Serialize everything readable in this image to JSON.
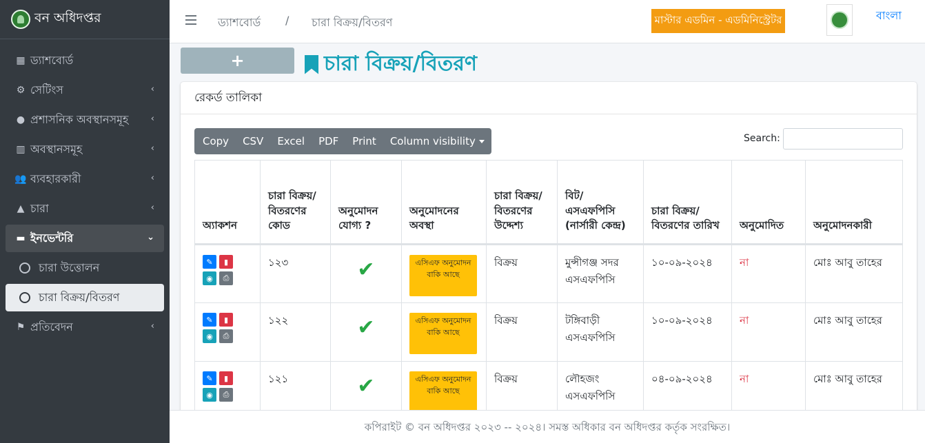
{
  "brand": {
    "title": "বন অধিদপ্তর"
  },
  "sidebar": {
    "items": [
      {
        "icon": "grid-icon",
        "label": "ড্যাশবোর্ড"
      },
      {
        "icon": "gear-icon",
        "label": "সেটিংস"
      },
      {
        "icon": "location-pin-icon",
        "label": "প্রশাসনিক অবস্থানসমূহ"
      },
      {
        "icon": "building-icon",
        "label": "অবস্থানসমূহ"
      },
      {
        "icon": "users-icon",
        "label": "ব্যবহারকারী"
      },
      {
        "icon": "tree-icon",
        "label": "চারা"
      },
      {
        "icon": "toolbox-icon",
        "label": "ইনভেন্টরি"
      },
      {
        "label": "চারা উত্তোলন"
      },
      {
        "label": "চারা বিক্রয়/বিতরণ"
      },
      {
        "icon": "flag-icon",
        "label": "প্রতিবেদন"
      }
    ]
  },
  "topbar": {
    "breadcrumb": [
      "ড্যাশবোর্ড",
      "/",
      "চারা বিক্রয়/বিতরণ"
    ],
    "role": "মাস্টার এডমিন - এডমিনিস্ট্রেটর",
    "language": "বাংলা"
  },
  "page": {
    "add_label": "+",
    "title": "চারা বিক্রয়/বিতরণ"
  },
  "card": {
    "header": "রেকর্ড তালিকা",
    "buttons": [
      "Copy",
      "CSV",
      "Excel",
      "PDF",
      "Print",
      "Column visibility"
    ],
    "search_label": "Search:"
  },
  "table": {
    "columns": [
      "অ্যাকশন",
      "চারা বিক্রয়/ বিতরণের কোড",
      "অনুমোদন যোগ্য ?",
      "অনুমোদনের অবস্থা",
      "চারা বিক্রয়/ বিতরণের উদ্দেশ্য",
      "বিট/ এসএফপিসি (নার্সারী কেন্দ্র)",
      "চারা বিক্রয়/ বিতরণের তারিখ",
      "অনুমোদিত",
      "অনুমোদনকারী"
    ],
    "rows": [
      {
        "code": "১২৩",
        "status": "এসিএফ অনুমোদন বাকি আছে",
        "purpose": "বিক্রয়",
        "center": "মুন্সীগঞ্জ সদর এসএফপিসি",
        "date": "১০-০৯-২০২৪",
        "approved": "না",
        "approver": "মোঃ আবু তাহের"
      },
      {
        "code": "১২২",
        "status": "এসিএফ অনুমোদন বাকি আছে",
        "purpose": "বিক্রয়",
        "center": "টঙ্গিবাড়ী এসএফপিসি",
        "date": "১০-০৯-২০২৪",
        "approved": "না",
        "approver": "মোঃ আবু তাহের"
      },
      {
        "code": "১২১",
        "status": "এসিএফ অনুমোদন বাকি আছে",
        "purpose": "বিক্রয়",
        "center": "লৌহজং এসএফপিসি",
        "date": "০৪-০৯-২০২৪",
        "approved": "না",
        "approver": "মোঃ আবু তাহের"
      }
    ]
  },
  "footer": {
    "text": "কপিরাইট © বন অধিদপ্তর ২০২৩ -- ২০২৪। সমস্ত অধিকার বন অধিদপ্তর কর্তৃক সংরক্ষিত।"
  }
}
